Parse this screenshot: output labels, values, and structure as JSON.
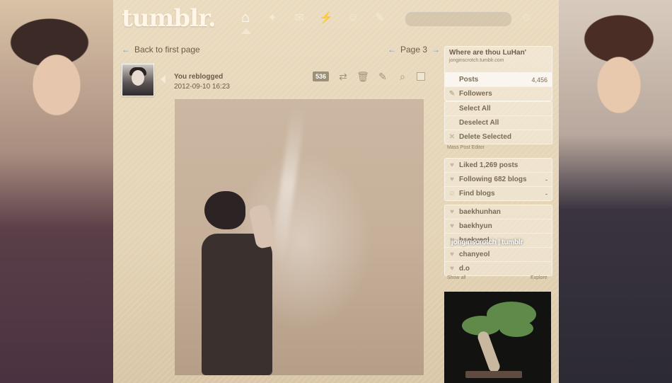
{
  "header": {
    "logo": "tumblr.",
    "nav_icons": [
      "home-icon",
      "explore-icon",
      "messages-icon",
      "activity-icon",
      "account-icon",
      "settings-icon"
    ],
    "search_placeholder": ""
  },
  "pagination": {
    "back_label": "Back to first page",
    "page_label": "Page 3"
  },
  "post": {
    "author_line": "You reblogged",
    "timestamp": "2012-09-10 16:23",
    "notes": "536"
  },
  "sidebar": {
    "blog": {
      "name": "Where are thou LuHan'",
      "url": "jonginscrotch.tumblr.com"
    },
    "stats": [
      {
        "label": "Posts",
        "count": "4,456"
      },
      {
        "label": "Followers",
        "count": ""
      }
    ],
    "mass_edit": [
      "Select All",
      "Deselect All",
      "Delete Selected"
    ],
    "mass_caption": "Mass Post Editor",
    "likes": [
      {
        "label": "Liked 1,269 posts",
        "suffix": ""
      },
      {
        "label": "Following 682 blogs",
        "suffix": "-"
      },
      {
        "label": "Find blogs",
        "suffix": "-"
      }
    ],
    "tags": [
      "baekhunhan",
      "baekhyun",
      "baekyeol",
      "chanyeol",
      "d.o"
    ],
    "show_all": "Show all",
    "explore": "Explore",
    "watermark": "jonginscrotch | tumblr"
  },
  "colors": {
    "accent": "#6f9ad0",
    "text": "#6c5c48",
    "panel_bg": "#eadbbf"
  }
}
